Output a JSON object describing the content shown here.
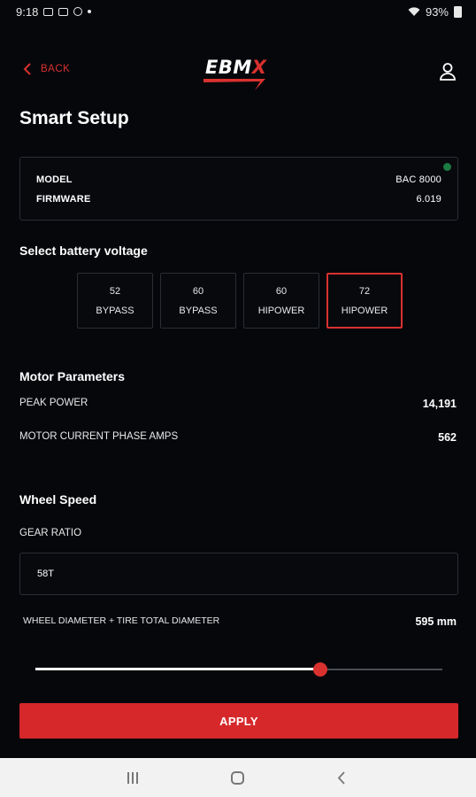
{
  "status_bar": {
    "time": "9:18",
    "battery": "93%"
  },
  "header": {
    "back_label": "BACK",
    "logo_text": "EBM",
    "logo_x": "X"
  },
  "page": {
    "title": "Smart Setup"
  },
  "device": {
    "model_label": "MODEL",
    "model_value": "BAC 8000",
    "firmware_label": "FIRMWARE",
    "firmware_value": "6.019",
    "status_color": "#1c7a43"
  },
  "voltage": {
    "heading": "Select battery voltage",
    "options": [
      {
        "volts": "52",
        "mode": "BYPASS",
        "selected": false
      },
      {
        "volts": "60",
        "mode": "BYPASS",
        "selected": false
      },
      {
        "volts": "60",
        "mode": "HIPOWER",
        "selected": false
      },
      {
        "volts": "72",
        "mode": "HIPOWER",
        "selected": true
      }
    ]
  },
  "motor": {
    "heading": "Motor Parameters",
    "peak_power_label": "PEAK POWER",
    "peak_power_value": "14,191",
    "phase_amps_label": "MOTOR CURRENT PHASE AMPS",
    "phase_amps_value": "562"
  },
  "wheel": {
    "heading": "Wheel Speed",
    "gear_ratio_label": "GEAR RATIO",
    "gear_ratio_value": "58T",
    "diameter_label": "WHEEL DIAMETER + TIRE TOTAL DIAMETER",
    "diameter_value": "595 mm",
    "slider_fraction": 0.7
  },
  "apply_label": "APPLY",
  "colors": {
    "accent": "#d6282a",
    "background": "#05070b",
    "border": "#2a2d33"
  }
}
